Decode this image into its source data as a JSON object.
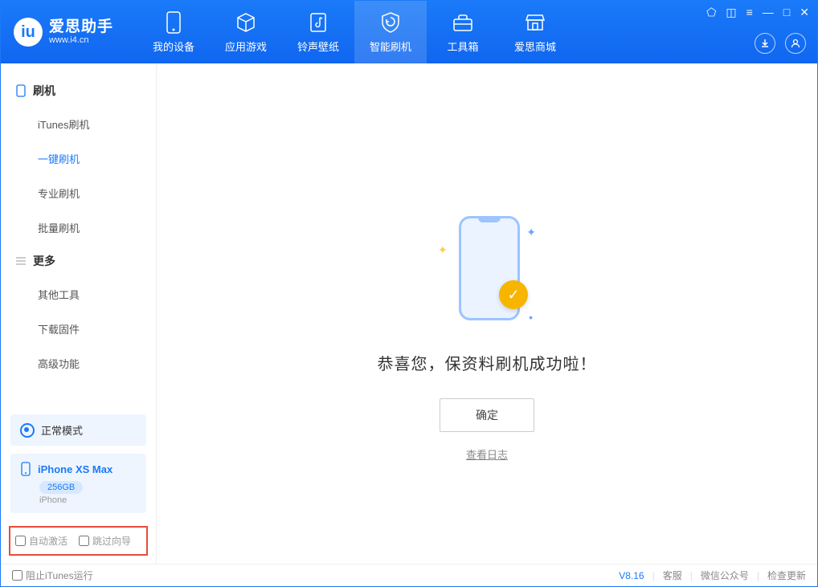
{
  "app": {
    "title": "爱思助手",
    "subtitle": "www.i4.cn"
  },
  "nav": {
    "tabs": [
      {
        "label": "我的设备",
        "icon": "device"
      },
      {
        "label": "应用游戏",
        "icon": "cube"
      },
      {
        "label": "铃声壁纸",
        "icon": "music"
      },
      {
        "label": "智能刷机",
        "icon": "shield"
      },
      {
        "label": "工具箱",
        "icon": "toolbox"
      },
      {
        "label": "爱思商城",
        "icon": "store"
      }
    ],
    "active_index": 3
  },
  "sidebar": {
    "groups": [
      {
        "title": "刷机",
        "items": [
          {
            "label": "iTunes刷机"
          },
          {
            "label": "一键刷机"
          },
          {
            "label": "专业刷机"
          },
          {
            "label": "批量刷机"
          }
        ],
        "active_index": 1
      },
      {
        "title": "更多",
        "items": [
          {
            "label": "其他工具"
          },
          {
            "label": "下载固件"
          },
          {
            "label": "高级功能"
          }
        ],
        "active_index": -1
      }
    ],
    "mode": {
      "label": "正常模式"
    },
    "device": {
      "name": "iPhone XS Max",
      "storage": "256GB",
      "type": "iPhone"
    },
    "options": {
      "auto_activate": "自动激活",
      "skip_guide": "跳过向导"
    }
  },
  "main": {
    "success_title": "恭喜您，保资料刷机成功啦！",
    "ok_button": "确定",
    "log_link": "查看日志"
  },
  "footer": {
    "block_itunes": "阻止iTunes运行",
    "version": "V8.16",
    "links": [
      "客服",
      "微信公众号",
      "检查更新"
    ]
  }
}
